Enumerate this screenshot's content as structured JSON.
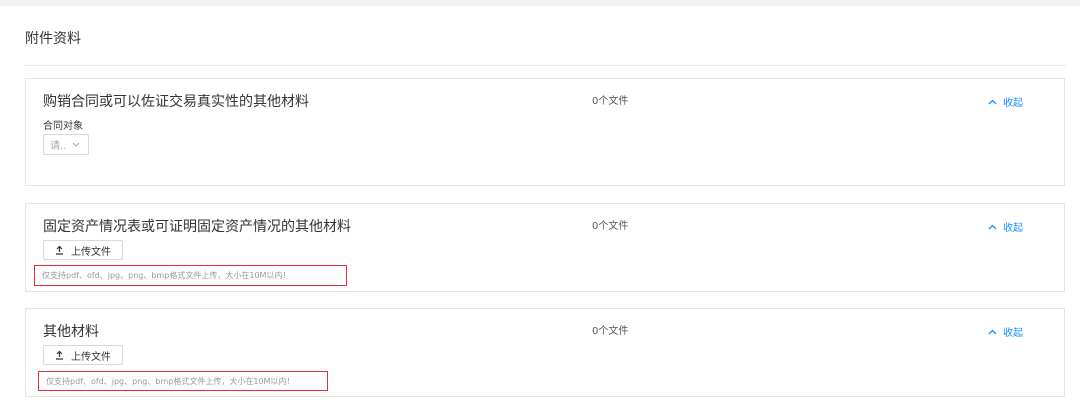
{
  "section_title": "附件资料",
  "cards": [
    {
      "title": "购销合同或可以佐证交易真实性的其他材料",
      "file_count": "0个文件",
      "collapse_label": "收起",
      "field_label": "合同对象",
      "select_placeholder": "请.."
    },
    {
      "title": "固定资产情况表或可证明固定资产情况的其他材料",
      "file_count": "0个文件",
      "collapse_label": "收起",
      "upload_label": "上传文件",
      "hint": "仅支持pdf、ofd、jpg、png、bmp格式文件上传，大小在10M以内！"
    },
    {
      "title": "其他材料",
      "file_count": "0个文件",
      "collapse_label": "收起",
      "upload_label": "上传文件",
      "hint": "仅支持pdf、ofd、jpg、png、bmp格式文件上传，大小在10M以内！"
    }
  ],
  "colors": {
    "accent": "#1890ff",
    "highlight_border": "#e0303a"
  },
  "icons": {
    "collapse": "chevron-up-icon",
    "select": "chevron-down-icon",
    "upload": "upload-icon"
  }
}
